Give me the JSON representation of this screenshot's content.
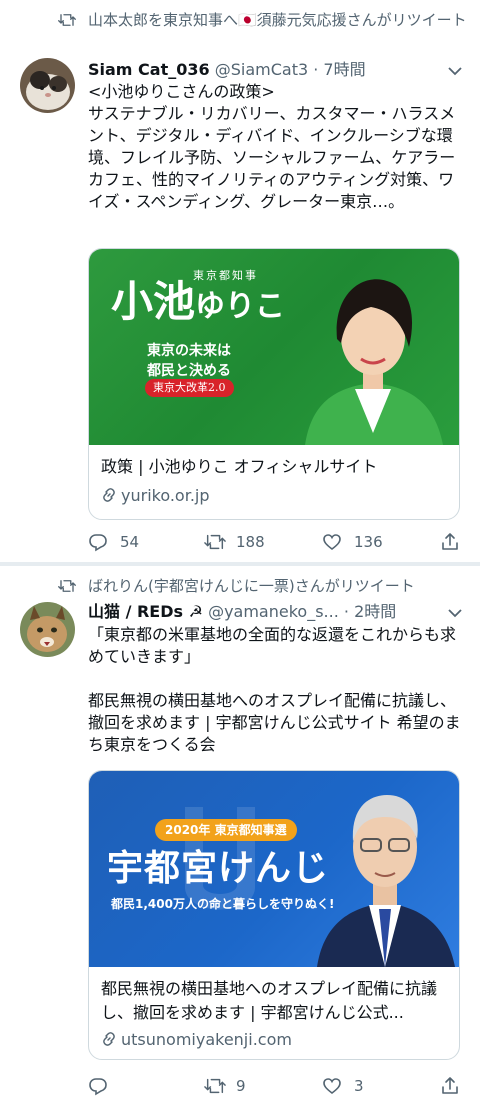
{
  "tweets": [
    {
      "retweet_by": "山本太郎を東京知事へ🇯🇵須藤元気応援さんがリツイート",
      "author_name": "Siam Cat_036",
      "author_handle": "@SiamCat3",
      "time": "· 7時間",
      "text": "<小池ゆりこさんの政策>\nサステナブル・リカバリー、カスタマー・ハラスメント、デジタル・ディバイド、インクルーシブな環境、フレイル予防、ソーシャルファーム、ケアラーカフェ、性的マイノリティのアウティング対策、ワイズ・スペンディング、グレーター東京…。",
      "card": {
        "banner_role": "東京都知事",
        "banner_name_a": "小池",
        "banner_name_b": "ゆりこ",
        "banner_slogan": "東京の未来は\n都民と決める",
        "banner_badge": "東京大改革2.0",
        "title": "政策 | 小池ゆりこ オフィシャルサイト",
        "domain": "yuriko.or.jp"
      },
      "replies": "54",
      "retweets": "188",
      "likes": "136"
    },
    {
      "retweet_by": "ばれりん(宇都宮けんじに一票)さんがリツイート",
      "author_name": "山猫 / REDs ☭",
      "author_handle": "@yamaneko_s...",
      "time": "· 2時間",
      "text": "「東京都の米軍基地の全面的な返還をこれからも求めていきます」\n\n都民無視の横田基地へのオスプレイ配備に抗議し、撤回を求めます | 宇都宮けんじ公式サイト 希望のまち東京をつくる会",
      "card": {
        "banner_badge": "2020年 東京都知事選",
        "banner_name": "宇都宮けんじ",
        "banner_sub": "都民1,400万人の命と暮らしを守りぬく!",
        "title": "都民無視の横田基地へのオスプレイ配備に抗議し、撤回を求めます | 宇都宮けんじ公式...",
        "domain": "utsunomiyakenji.com"
      },
      "replies": "",
      "retweets": "9",
      "likes": "3"
    }
  ],
  "colors": {
    "muted": "#536471",
    "border": "#cfd9de",
    "text": "#0f1419",
    "separator": "#e6ecf0"
  },
  "icons": [
    "retweet-icon",
    "chevron-down-icon",
    "reply-icon",
    "like-icon",
    "share-icon",
    "link-icon"
  ]
}
